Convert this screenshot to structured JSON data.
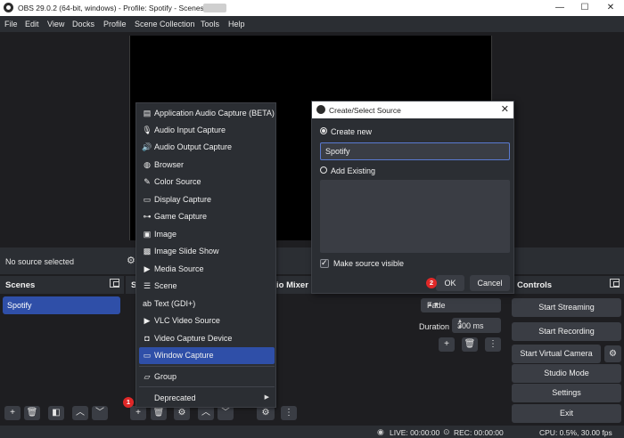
{
  "window": {
    "title": "OBS 29.0.2 (64-bit, windows) - Profile: Spotify - Scenes:",
    "minimize": "—",
    "maximize": "☐",
    "close": "✕"
  },
  "menu": [
    "File",
    "Edit",
    "View",
    "Docks",
    "Profile",
    "Scene Collection",
    "Tools",
    "Help"
  ],
  "source_bar": {
    "no_source": "No source selected"
  },
  "scenes": {
    "title": "Scenes",
    "items": [
      "Spotify"
    ]
  },
  "sources": {
    "title": "S"
  },
  "mixer": {
    "title": "io Mixer"
  },
  "transitions": {
    "type": "Fade",
    "duration_label": "Duration",
    "duration_value": "300 ms"
  },
  "controls": {
    "title": "Controls",
    "buttons": [
      "Start Streaming",
      "Start Recording",
      "Start Virtual Camera",
      "Studio Mode",
      "Settings",
      "Exit"
    ]
  },
  "context_menu": {
    "items": [
      {
        "label": "Application Audio Capture (BETA)",
        "icon": "app-audio-icon"
      },
      {
        "label": "Audio Input Capture",
        "icon": "microphone-icon"
      },
      {
        "label": "Audio Output Capture",
        "icon": "speaker-icon"
      },
      {
        "label": "Browser",
        "icon": "globe-icon"
      },
      {
        "label": "Color Source",
        "icon": "brush-icon"
      },
      {
        "label": "Display Capture",
        "icon": "monitor-icon"
      },
      {
        "label": "Game Capture",
        "icon": "gamepad-icon"
      },
      {
        "label": "Image",
        "icon": "image-icon"
      },
      {
        "label": "Image Slide Show",
        "icon": "slideshow-icon"
      },
      {
        "label": "Media Source",
        "icon": "play-icon"
      },
      {
        "label": "Scene",
        "icon": "list-icon"
      },
      {
        "label": "Text (GDI+)",
        "icon": "text-icon"
      },
      {
        "label": "VLC Video Source",
        "icon": "play-icon"
      },
      {
        "label": "Video Capture Device",
        "icon": "camera-icon"
      },
      {
        "label": "Window Capture",
        "icon": "window-icon"
      },
      {
        "label": "Group",
        "icon": "folder-icon"
      },
      {
        "label": "Deprecated",
        "icon": ""
      }
    ],
    "selected": "Window Capture"
  },
  "dialog": {
    "title": "Create/Select Source",
    "create_new": "Create new",
    "name_value": "Spotify",
    "add_existing": "Add Existing",
    "make_visible": "Make source visible",
    "ok": "OK",
    "cancel": "Cancel"
  },
  "badges": {
    "one": "1",
    "two": "2"
  },
  "status": {
    "live": "LIVE: 00:00:00",
    "rec": "REC: 00:00:00",
    "cpu": "CPU: 0.5%, 30.00 fps"
  },
  "colors": {
    "background": "#1e1e21",
    "panel": "#2b2e33",
    "button": "#3a3d44",
    "accent": "#2f4fa8",
    "badge": "#e02828"
  }
}
